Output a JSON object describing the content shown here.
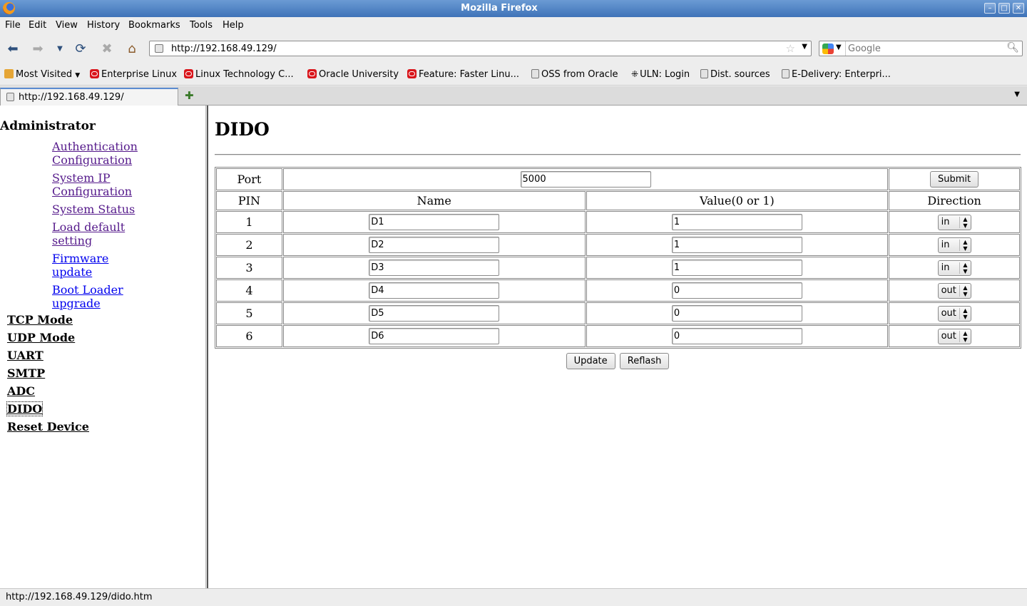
{
  "window": {
    "title": "Mozilla Firefox",
    "controls": [
      "–",
      "□",
      "✕"
    ]
  },
  "menu": [
    "File",
    "Edit",
    "View",
    "History",
    "Bookmarks",
    "Tools",
    "Help"
  ],
  "navbar": {
    "url": "http://192.168.49.129/",
    "search_placeholder": "Google"
  },
  "bookmarks": [
    {
      "label": "Most Visited",
      "icon": "folder-icon"
    },
    {
      "label": "Enterprise Linux",
      "icon": "oracle-icon"
    },
    {
      "label": "Linux Technology C...",
      "icon": "oracle-icon"
    },
    {
      "label": "Oracle University",
      "icon": "oracle-icon"
    },
    {
      "label": "Feature: Faster Linu...",
      "icon": "oracle-icon"
    },
    {
      "label": "OSS from Oracle",
      "icon": "page-icon"
    },
    {
      "label": "ULN: Login",
      "icon": "uln-icon"
    },
    {
      "label": "Dist. sources",
      "icon": "page-icon"
    },
    {
      "label": "E-Delivery: Enterpri...",
      "icon": "page-icon"
    }
  ],
  "tab": {
    "label": "http://192.168.49.129/"
  },
  "sidebar": {
    "heading": "Administrator",
    "sublinks": [
      "Authentication Configuration",
      "System IP Configuration",
      "System Status",
      "Load default setting",
      "Firmware update",
      "Boot Loader upgrade"
    ],
    "links": [
      "TCP Mode",
      "UDP Mode",
      "UART",
      "SMTP",
      "ADC",
      "DIDO",
      "Reset Device"
    ],
    "active": "DIDO"
  },
  "main": {
    "title": "DIDO",
    "port_label": "Port",
    "port_value": "5000",
    "submit_label": "Submit",
    "headers": {
      "pin": "PIN",
      "name": "Name",
      "value": "Value(0 or 1)",
      "direction": "Direction"
    },
    "rows": [
      {
        "pin": "1",
        "name": "D1",
        "value": "1",
        "direction": "in"
      },
      {
        "pin": "2",
        "name": "D2",
        "value": "1",
        "direction": "in"
      },
      {
        "pin": "3",
        "name": "D3",
        "value": "1",
        "direction": "in"
      },
      {
        "pin": "4",
        "name": "D4",
        "value": "0",
        "direction": "out"
      },
      {
        "pin": "5",
        "name": "D5",
        "value": "0",
        "direction": "out"
      },
      {
        "pin": "6",
        "name": "D6",
        "value": "0",
        "direction": "out"
      }
    ],
    "update_label": "Update",
    "refresh_label": "Reflash"
  },
  "status": "http://192.168.49.129/dido.htm"
}
